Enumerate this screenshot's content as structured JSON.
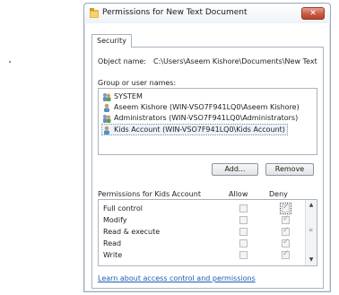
{
  "window": {
    "title": "Permissions for New Text Document",
    "close_glyph": "✕"
  },
  "tabs": [
    {
      "label": "Security"
    }
  ],
  "object": {
    "label": "Object name:",
    "value": "C:\\Users\\Aseem Kishore\\Documents\\New Text Dc"
  },
  "groups": {
    "label": "Group or user names:",
    "items": [
      {
        "name": "SYSTEM",
        "icon": "group-icon"
      },
      {
        "name": "Aseem Kishore (WIN-VSO7F941LQ0\\Aseem Kishore)",
        "icon": "user-icon"
      },
      {
        "name": "Administrators (WIN-VSO7F941LQ0\\Administrators)",
        "icon": "group-icon"
      },
      {
        "name": "Kids Account (WIN-VSO7F941LQ0\\Kids Account)",
        "icon": "user-icon",
        "selected": true
      }
    ]
  },
  "buttons": {
    "add": "Add...",
    "remove": "Remove"
  },
  "permissions": {
    "label": "Permissions for Kids Account",
    "col_allow": "Allow",
    "col_deny": "Deny",
    "check_glyph": "✓",
    "rows": [
      {
        "name": "Full control",
        "allow": false,
        "deny": true
      },
      {
        "name": "Modify",
        "allow": false,
        "deny": true
      },
      {
        "name": "Read & execute",
        "allow": false,
        "deny": true
      },
      {
        "name": "Read",
        "allow": false,
        "deny": true
      },
      {
        "name": "Write",
        "allow": false,
        "deny": true
      }
    ]
  },
  "scrollbar": {
    "up": "▲",
    "down": "▼",
    "grip": "≡"
  },
  "link": {
    "learn": "Learn about access control and permissions"
  },
  "colors": {
    "accent_link": "#1f5bb3",
    "close_button": "#c75c42",
    "folder_icon": "#e8b642"
  }
}
